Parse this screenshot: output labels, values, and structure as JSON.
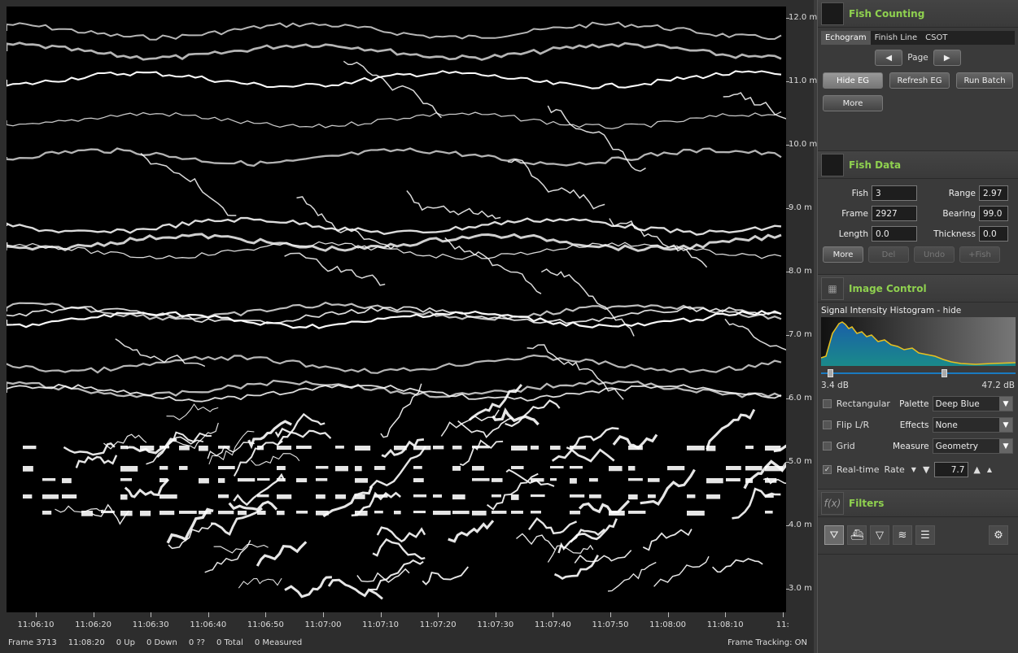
{
  "depth_axis": {
    "labels": [
      "12.0 m",
      "11.0 m",
      "10.0 m",
      "9.0 m",
      "8.0 m",
      "7.0 m",
      "6.0 m",
      "5.0 m",
      "4.0 m",
      "3.0 m"
    ],
    "values": [
      12.0,
      11.0,
      10.0,
      9.0,
      8.0,
      7.0,
      6.0,
      5.0,
      4.0,
      3.0
    ]
  },
  "time_axis": {
    "labels": [
      "11:06:10",
      "11:06:20",
      "11:06:30",
      "11:06:40",
      "11:06:50",
      "11:07:00",
      "11:07:10",
      "11:07:20",
      "11:07:30",
      "11:07:40",
      "11:07:50",
      "11:08:00",
      "11:08:10",
      "11:"
    ]
  },
  "status": {
    "frame": "Frame 3713",
    "time": "11:08:20",
    "up": "0 Up",
    "down": "0 Down",
    "unknown": "0 ??",
    "total": "0 Total",
    "measured": "0 Measured",
    "tracking": "Frame Tracking: ON"
  },
  "fish_counting": {
    "title": "Fish Counting",
    "tabs": [
      "Echogram",
      "Finish Line",
      "CSOT"
    ],
    "page_label": "Page",
    "prev_icon": "triangle-left-icon",
    "next_icon": "triangle-right-icon",
    "hide_eg": "Hide EG",
    "refresh_eg": "Refresh EG",
    "run_batch": "Run Batch",
    "more": "More"
  },
  "fish_data": {
    "title": "Fish Data",
    "fish_label": "Fish",
    "fish_value": "3",
    "range_label": "Range",
    "range_value": "2.97",
    "frame_label": "Frame",
    "frame_value": "2927",
    "bearing_label": "Bearing",
    "bearing_value": "99.0",
    "length_label": "Length",
    "length_value": "0.0",
    "thickness_label": "Thickness",
    "thickness_value": "0.0",
    "more": "More",
    "del": "Del",
    "undo": "Undo",
    "add_fish": "+Fish"
  },
  "image_control": {
    "title": "Image Control",
    "histogram_title": "Signal Intensity Histogram - hide",
    "min_db": "3.4 dB",
    "max_db": "47.2 dB",
    "rectangular": "Rectangular",
    "flip": "Flip L/R",
    "grid": "Grid",
    "realtime": "Real-time",
    "palette_label": "Palette",
    "palette_value": "Deep Blue",
    "effects_label": "Effects",
    "effects_value": "None",
    "measure_label": "Measure",
    "measure_value": "Geometry",
    "rate_label": "Rate",
    "rate_value": "7.7"
  },
  "filters": {
    "title": "Filters",
    "icon": "fx-icon",
    "buttons": [
      "funnel-icon",
      "boat-icon",
      "cone-icon",
      "wave-icon",
      "stack-icon"
    ],
    "settings_icon": "gear-icon"
  },
  "colors": {
    "accent": "#8fd14f",
    "histogram_line": "#e8c020",
    "histogram_fill_top": "#1a5fa8",
    "histogram_fill_bottom": "#1a8a8a"
  }
}
